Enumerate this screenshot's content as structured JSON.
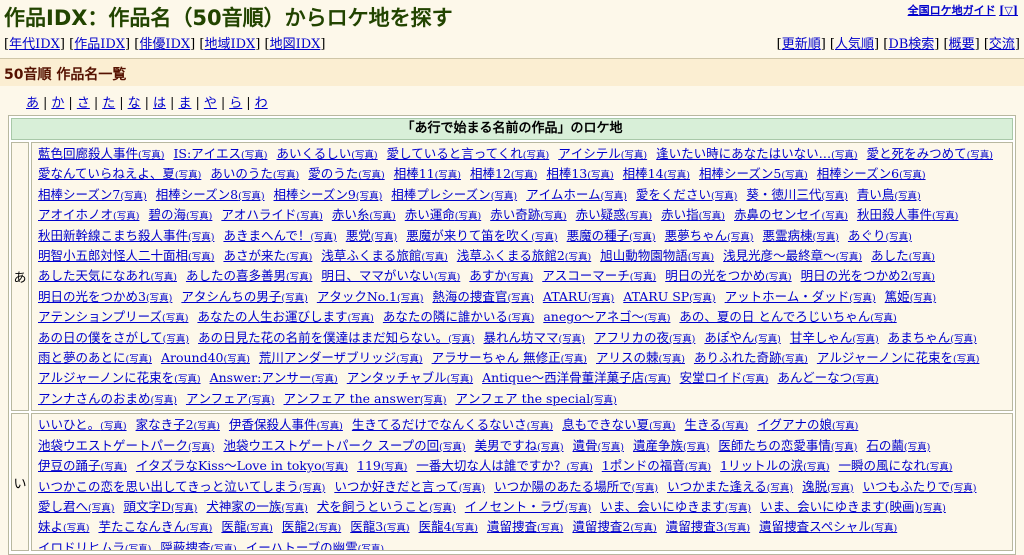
{
  "header": {
    "title": "作品IDX：作品名（50音順）からロケ地を探す",
    "guide_link": "全国ロケ地ガイド",
    "guide_menu": "[▽]"
  },
  "nav_left": [
    "年代IDX",
    "作品IDX",
    "俳優IDX",
    "地域IDX",
    "地図IDX"
  ],
  "nav_right": [
    "更新順",
    "人気順",
    "DB検索",
    "概要",
    "交流"
  ],
  "section_title": "50音順 作品名一覧",
  "kana_nav": [
    "あ",
    "か",
    "さ",
    "た",
    "な",
    "は",
    "ま",
    "や",
    "ら",
    "わ"
  ],
  "photo_label": "(写真)",
  "list_header": "「あ行で始まる名前の作品」のロケ地",
  "groups": [
    {
      "label": "あ",
      "items": [
        "藍色回廊殺人事件",
        "IS:アイエス",
        "あいくるしい",
        "愛していると言ってくれ",
        "アイシテル",
        "逢いたい時にあなたはいない…",
        "愛と死をみつめて",
        "愛なんていらねえよ、夏",
        "あいのうた",
        "愛のうた",
        "相棒11",
        "相棒12",
        "相棒13",
        "相棒14",
        "相棒シーズン5",
        "相棒シーズン6",
        "相棒シーズン7",
        "相棒シーズン8",
        "相棒シーズン9",
        "相棒プレシーズン",
        "アイムホーム",
        "愛をください",
        "葵・徳川三代",
        "青い鳥",
        "アオイホノオ",
        "碧の海",
        "アオハライド",
        "赤い糸",
        "赤い運命",
        "赤い奇跡",
        "赤い疑惑",
        "赤い指",
        "赤鼻のセンセイ",
        "秋田殺人事件",
        "秋田新幹線こまち殺人事件",
        "あきまへんで！",
        "悪党",
        "悪魔が来りて笛を吹く",
        "悪魔の種子",
        "悪夢ちゃん",
        "悪霊病棟",
        "あぐり",
        "明智小五郎対怪人二十面相",
        "あさが来た",
        "浅草ふくまる旅館",
        "浅草ふくまる旅館2",
        "旭山動物園物語",
        "浅見光彦～最終章～",
        "あした",
        "あした天気になあれ",
        "あしたの喜多善男",
        "明日、ママがいない",
        "あすか",
        "アスコーマーチ",
        "明日の光をつかめ",
        "明日の光をつかめ2",
        "明日の光をつかめ3",
        "アタシんちの男子",
        "アタックNo.1",
        "熱海の捜査官",
        "ATARU",
        "ATARU SP",
        "アットホーム・ダッド",
        "篤姫",
        "アテンションプリーズ",
        "あなたの人生お運びします",
        "あなたの隣に誰かいる",
        "anego～アネゴ～",
        "あの、夏の日 とんでろじいちゃん",
        "あの日の僕をさがして",
        "あの日見た花の名前を僕達はまだ知らない。",
        "暴れん坊ママ",
        "アフリカの夜",
        "あぽやん",
        "甘辛しゃん",
        "あまちゃん",
        "雨と夢のあとに",
        "Around40",
        "荒川アンダーザブリッジ",
        "アラサーちゃん 無修正",
        "アリスの棘",
        "ありふれた奇跡",
        "アルジャーノンに花束を",
        "アルジャーノンに花束を",
        "Answer:アンサー",
        "アンタッチャブル",
        "Antique～西洋骨董洋菓子店",
        "安堂ロイド",
        "あんどーなつ",
        "アンナさんのおまめ",
        "アンフェア",
        "アンフェア the answer",
        "アンフェア the special"
      ]
    },
    {
      "label": "い",
      "items": [
        "いいひと。",
        "家なき子2",
        "伊香保殺人事件",
        "生きてるだけでなんくるないさ",
        "息もできない夏",
        "生きる",
        "イグアナの娘",
        "池袋ウエストゲートパーク",
        "池袋ウエストゲートパーク スープの回",
        "美男ですね",
        "遺骨",
        "遺産争族",
        "医師たちの恋愛事情",
        "石の繭",
        "伊豆の踊子",
        "イタズラなKiss～Love in tokyo",
        "119",
        "一番大切な人は誰ですか？",
        "1ポンドの福音",
        "1リットルの涙",
        "一瞬の風になれ",
        "いつかこの恋を思い出してきっと泣いてしまう",
        "いつか好きだと言って",
        "いつか陽のあたる場所で",
        "いつかまた逢える",
        "逸脱",
        "いつもふたりで",
        "愛し君へ",
        "頭文字D",
        "犬神家の一族",
        "犬を飼うということ",
        "イノセント・ラヴ",
        "いま、会いにゆきます",
        "いま、会いにゆきます(映画)",
        "妹よ",
        "芋たこなんきん",
        "医龍",
        "医龍2",
        "医龍3",
        "医龍4",
        "遺留捜査",
        "遺留捜査2",
        "遺留捜査3",
        "遺留捜査スペシャル",
        "イロドリヒムラ",
        "隠蔽捜査",
        "イーハトーブの幽霊"
      ]
    }
  ]
}
